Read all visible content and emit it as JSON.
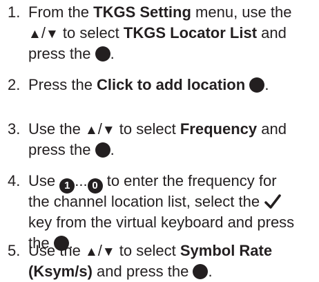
{
  "steps": [
    {
      "number": "1.",
      "lines": [
        [
          "From the ",
          {
            "b": "TKGS Setting"
          },
          " menu, use the"
        ],
        [
          {
            "icon": "up-arrow-icon"
          },
          "/",
          {
            "icon": "down-arrow-icon"
          },
          " to select ",
          {
            "b": "TKGS Locator List"
          },
          " and"
        ],
        [
          "press the ",
          {
            "icon": "ok-button-icon"
          },
          "."
        ]
      ]
    },
    {
      "number": "2.",
      "lines": [
        [
          "Press the ",
          {
            "b": "Click to add location"
          },
          " ",
          {
            "icon": "ok-button-icon"
          },
          "."
        ]
      ]
    },
    {
      "number": "3.",
      "lines": [
        [
          "Use the ",
          {
            "icon": "up-arrow-icon"
          },
          "/",
          {
            "icon": "down-arrow-icon"
          },
          " to select ",
          {
            "b": "Frequency"
          },
          " and"
        ],
        [
          "press the ",
          {
            "icon": "ok-button-icon"
          },
          "."
        ]
      ]
    },
    {
      "number": "4.",
      "lines": [
        [
          "Use ",
          {
            "icon": "number-1-button-icon",
            "label": "1"
          },
          "...",
          {
            "icon": "number-0-button-icon",
            "label": "0"
          },
          " to enter the frequency for"
        ],
        [
          "the channel location list, select the ",
          {
            "icon": "checkmark-icon"
          }
        ],
        [
          "key from the virtual keyboard and press"
        ],
        [
          "the ",
          {
            "icon": "ok-button-icon"
          },
          "."
        ]
      ]
    },
    {
      "number": "5.",
      "lines": [
        [
          "Use the ",
          {
            "icon": "up-arrow-icon"
          },
          "/",
          {
            "icon": "down-arrow-icon"
          },
          " to select ",
          {
            "b": "Symbol Rate"
          }
        ],
        [
          {
            "b": "(Ksym/s)"
          },
          " and press the ",
          {
            "icon": "ok-button-icon"
          },
          "."
        ]
      ]
    }
  ]
}
